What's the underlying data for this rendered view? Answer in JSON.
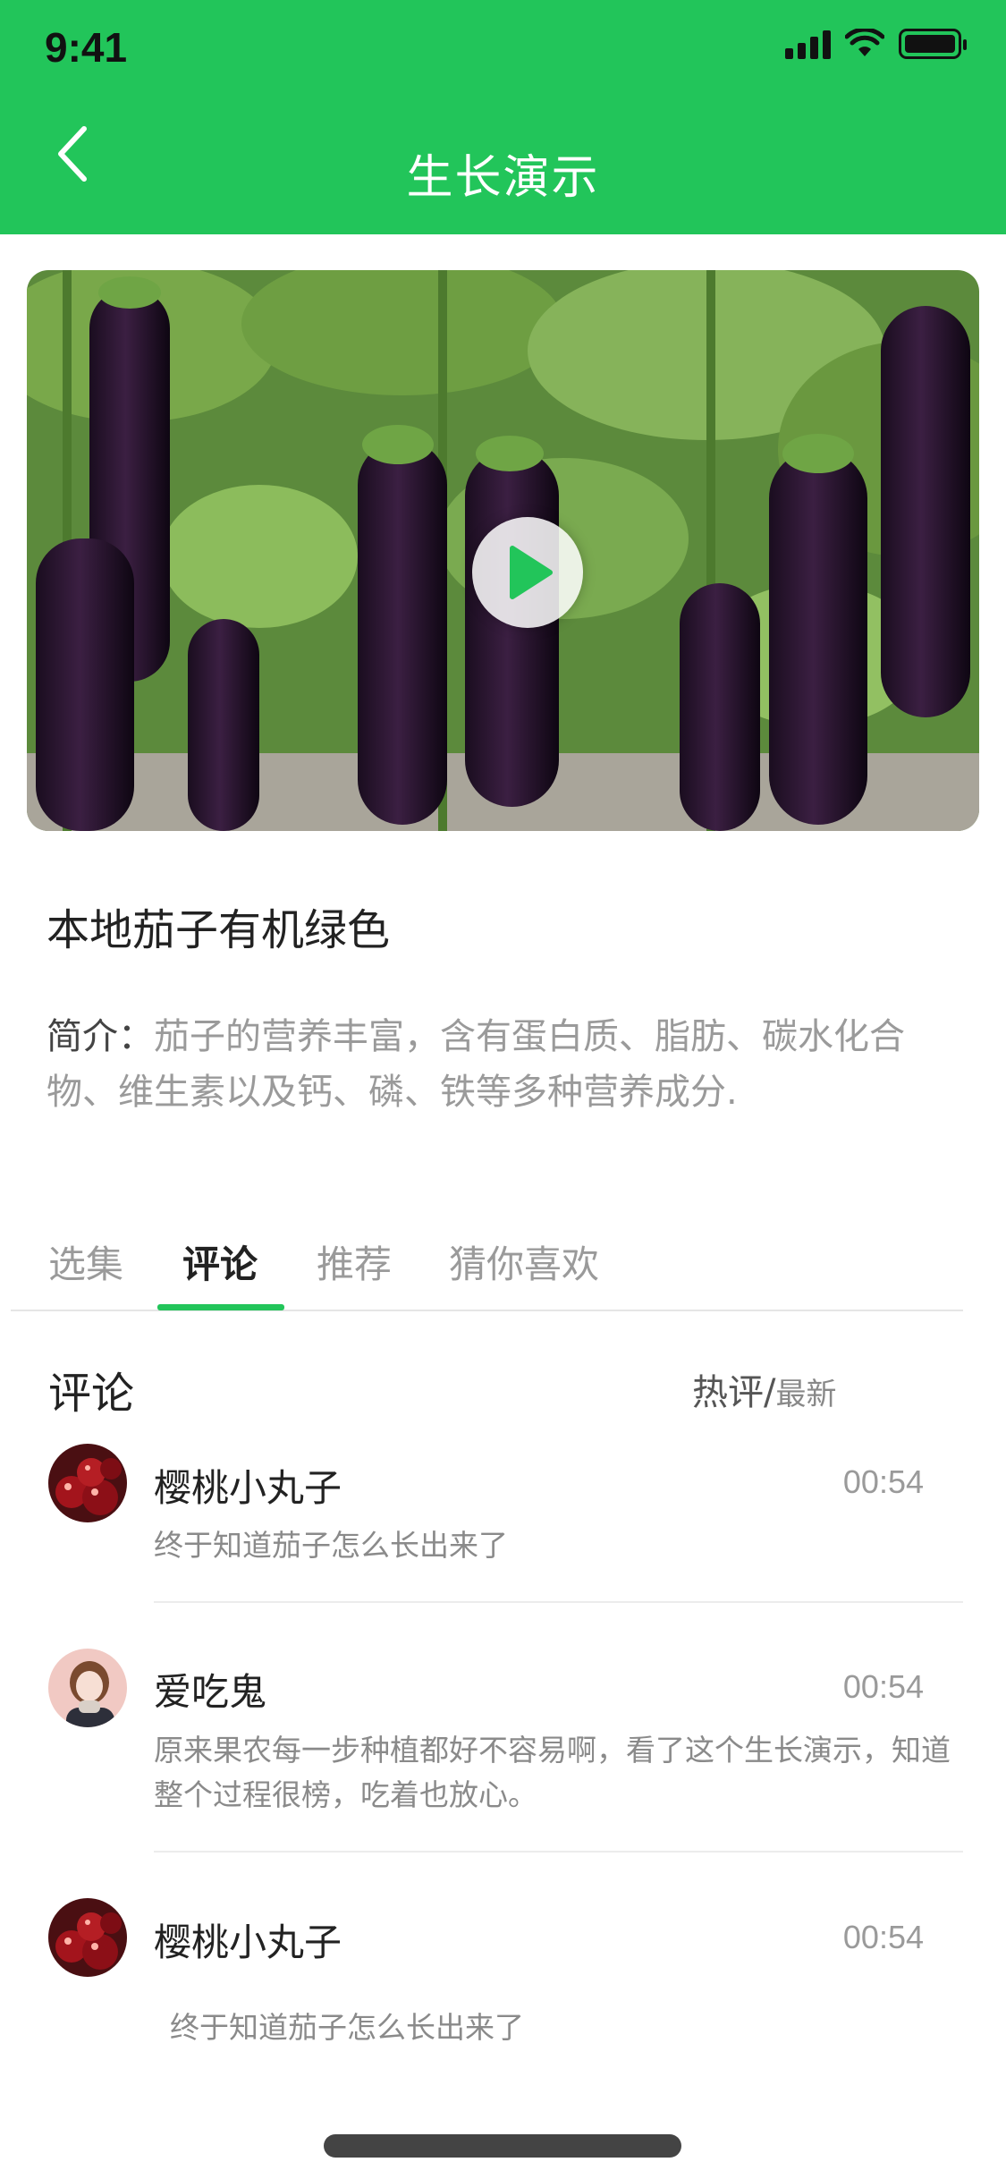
{
  "status_bar": {
    "time": "9:41"
  },
  "header": {
    "title": "生长演示"
  },
  "product": {
    "title": "本地茄子有机绿色",
    "intro_label": "简介：",
    "intro_text": "茄子的营养丰富，含有蛋白质、脂肪、碳水化合物、维生素以及钙、磷、铁等多种营养成分."
  },
  "tabs": [
    {
      "label": "选集"
    },
    {
      "label": "评论"
    },
    {
      "label": "推荐"
    },
    {
      "label": "猜你喜欢"
    }
  ],
  "comments_section": {
    "heading": "评论",
    "sort_hot": "热评",
    "sort_sep": "/",
    "sort_new": "最新"
  },
  "comments": [
    {
      "name": "樱桃小丸子",
      "time": "00:54",
      "text": "终于知道茄子怎么长出来了"
    },
    {
      "name": "爱吃鬼",
      "time": "00:54",
      "text": "原来果农每一步种植都好不容易啊，看了这个生长演示，知道整个过程很榜，吃着也放心。"
    },
    {
      "name": "樱桃小丸子",
      "time": "00:54",
      "text": "终于知道茄子怎么长出来了"
    }
  ],
  "colors": {
    "brand": "#22c55a",
    "text": "#222222",
    "muted": "#9a9a9a"
  },
  "icons": {
    "back": "chevron-left-icon",
    "play": "play-icon",
    "signal": "signal-icon",
    "wifi": "wifi-icon",
    "battery": "battery-icon"
  }
}
